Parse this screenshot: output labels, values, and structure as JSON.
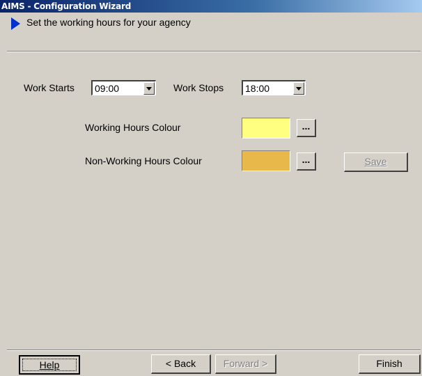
{
  "window": {
    "title": "AIMS - Configuration Wizard"
  },
  "banner": {
    "instruction": "Set the working hours for your agency"
  },
  "form": {
    "work_starts_label": "Work Starts",
    "work_starts_value": "09:00",
    "work_stops_label": "Work Stops",
    "work_stops_value": "18:00",
    "working_colour_label": "Working Hours Colour",
    "working_colour": "#ffff80",
    "non_working_colour_label": "Non-Working Hours Colour",
    "non_working_colour": "#e8b84a",
    "browse_label": "...",
    "save_label": "Save"
  },
  "footer": {
    "help_label": "Help",
    "back_label": "< Back",
    "forward_label": "Forward >",
    "finish_label": "Finish"
  }
}
